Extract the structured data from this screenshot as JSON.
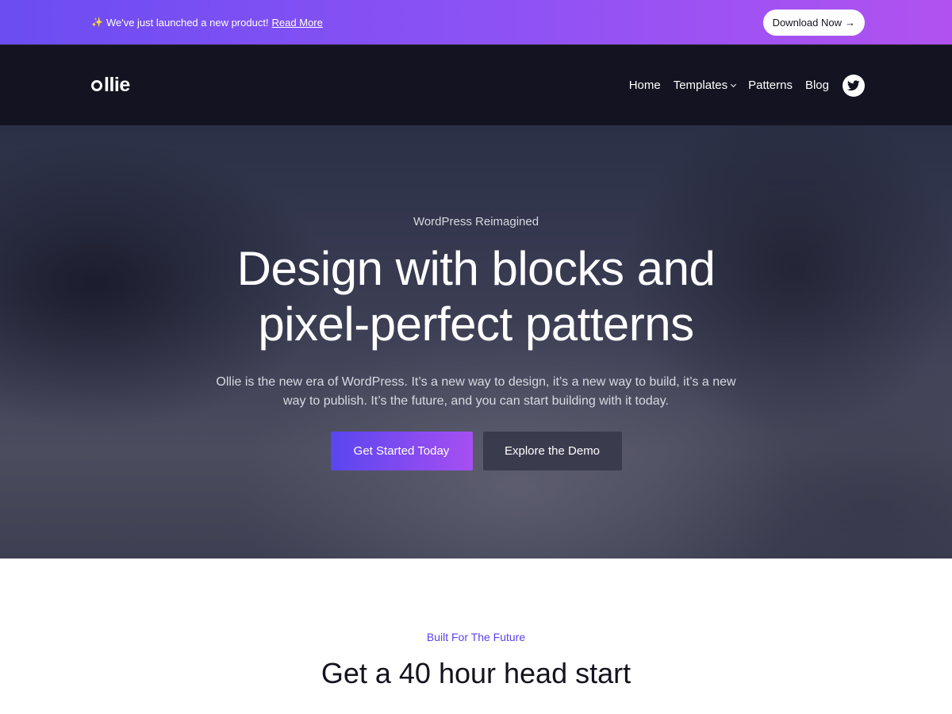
{
  "announcement": {
    "icon": "sparkles-icon",
    "text": "We've just launched a new product!",
    "link_label": "Read More",
    "download_label": "Download Now",
    "download_arrow": "→"
  },
  "header": {
    "logo_text": "llie",
    "nav": {
      "home": "Home",
      "templates": "Templates",
      "patterns": "Patterns",
      "blog": "Blog"
    },
    "social_icon": "twitter-icon"
  },
  "hero": {
    "eyebrow": "WordPress Reimagined",
    "title": "Design with blocks and pixel-perfect patterns",
    "description": "Ollie is the new era of WordPress. It’s a new way to design, it’s a new way to build, it’s a new way to publish. It’s the future, and you can start building with it today.",
    "primary_button": "Get Started Today",
    "secondary_button": "Explore the Demo"
  },
  "features": {
    "eyebrow": "Built For The Future",
    "title": "Get a 40 hour head start"
  },
  "colors": {
    "brand_gradient_start": "#6b4df2",
    "brand_gradient_end": "#b152f0",
    "header_bg": "#141321",
    "accent": "#5b42f0"
  }
}
